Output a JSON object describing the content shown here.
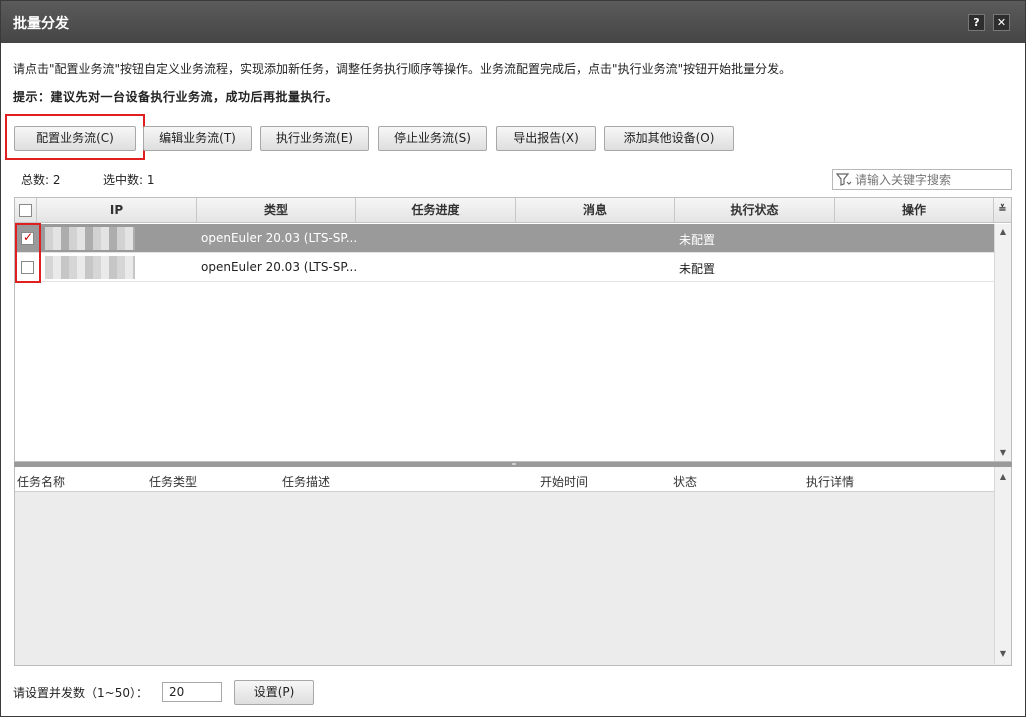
{
  "window": {
    "title": "批量分发",
    "help_label": "?",
    "close_label": "✕"
  },
  "description": "请点击\"配置业务流\"按钮自定义业务流程，实现添加新任务，调整任务执行顺序等操作。业务流配置完成后，点击\"执行业务流\"按钮开始批量分发。",
  "tip": "提示：建议先对一台设备执行业务流，成功后再批量执行。",
  "toolbar": {
    "config_label": "配置业务流(C)",
    "edit_label": "编辑业务流(T)",
    "execute_label": "执行业务流(E)",
    "stop_label": "停止业务流(S)",
    "export_label": "导出报告(X)",
    "add_device_label": "添加其他设备(O)"
  },
  "counts": {
    "total": "总数: 2",
    "selected": "选中数: 1"
  },
  "search": {
    "placeholder": "请输入关键字搜索"
  },
  "device_table": {
    "columns": [
      "IP",
      "类型",
      "任务进度",
      "消息",
      "执行状态",
      "操作"
    ],
    "rows": [
      {
        "checked": true,
        "ip": "",
        "type": "openEuler 20.03 (LTS-SP...",
        "progress": "",
        "message": "",
        "status": "未配置",
        "action": ""
      },
      {
        "checked": false,
        "ip": "",
        "type": "openEuler 20.03 (LTS-SP...",
        "progress": "",
        "message": "",
        "status": "未配置",
        "action": ""
      }
    ]
  },
  "task_table": {
    "columns": [
      "任务名称",
      "任务类型",
      "任务描述",
      "开始时间",
      "状态",
      "执行详情"
    ]
  },
  "footer": {
    "concurrency_label": "请设置并发数（1~50）：",
    "concurrency_value": "20",
    "set_label": "设置(P)"
  },
  "colors": {
    "title_bar": "#4a4a4a",
    "selected_row": "#9a9a9a",
    "highlight": "#e02020"
  }
}
